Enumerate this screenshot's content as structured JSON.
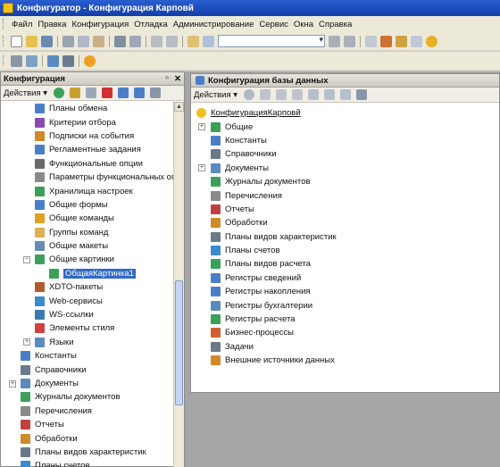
{
  "window": {
    "title": "Конфигуратор - Конфигурация Карповй"
  },
  "menu": [
    {
      "label": "Файл"
    },
    {
      "label": "Правка"
    },
    {
      "label": "Конфигурация"
    },
    {
      "label": "Отладка"
    },
    {
      "label": "Администрирование"
    },
    {
      "label": "Сервис"
    },
    {
      "label": "Окна"
    },
    {
      "label": "Справка"
    }
  ],
  "left_panel": {
    "title": "Конфигурация",
    "pin": " ⁿ",
    "close": "✕",
    "actions_label": "Действия ▾",
    "tree": [
      {
        "label": "Планы обмена",
        "indent": 2,
        "color": "#4a7fc8"
      },
      {
        "label": "Критерии отбора",
        "indent": 2,
        "color": "#8a4bb0"
      },
      {
        "label": "Подписки на события",
        "indent": 2,
        "color": "#d08a2a"
      },
      {
        "label": "Регламентные задания",
        "indent": 2,
        "color": "#4a7fc8"
      },
      {
        "label": "Функциональные опции",
        "indent": 2,
        "color": "#6a6a6a"
      },
      {
        "label": "Параметры функциональных опций",
        "indent": 2,
        "color": "#8a8a8a"
      },
      {
        "label": "Хранилища настроек",
        "indent": 2,
        "color": "#3aa05a"
      },
      {
        "label": "Общие формы",
        "indent": 2,
        "color": "#4a7fc8"
      },
      {
        "label": "Общие команды",
        "indent": 2,
        "color": "#e0a020"
      },
      {
        "label": "Группы команд",
        "indent": 2,
        "color": "#e0b050"
      },
      {
        "label": "Общие макеты",
        "indent": 2,
        "color": "#6a8ab0"
      },
      {
        "label": "Общие картинки",
        "indent": 2,
        "color": "#3aa05a",
        "expander": "−"
      },
      {
        "label": "ОбщаяКартинка1",
        "indent": 3,
        "color": "#3aa05a",
        "selected": true
      },
      {
        "label": "XDTO-пакеты",
        "indent": 2,
        "color": "#b05a30"
      },
      {
        "label": "Web-сервисы",
        "indent": 2,
        "color": "#3a8ad0"
      },
      {
        "label": "WS-ссылки",
        "indent": 2,
        "color": "#3a7ab0"
      },
      {
        "label": "Элементы стиля",
        "indent": 2,
        "color": "#d04040"
      },
      {
        "label": "Языки",
        "indent": 2,
        "color": "#5a8ac0",
        "expander": "+"
      },
      {
        "label": "Константы",
        "indent": 1,
        "color": "#4a7fc8"
      },
      {
        "label": "Справочники",
        "indent": 1,
        "color": "#6a7a8a"
      },
      {
        "label": "Документы",
        "indent": 1,
        "color": "#5a8ac0",
        "expander": "+"
      },
      {
        "label": "Журналы документов",
        "indent": 1,
        "color": "#3aa05a"
      },
      {
        "label": "Перечисления",
        "indent": 1,
        "color": "#8a8a8a"
      },
      {
        "label": "Отчеты",
        "indent": 1,
        "color": "#c04040"
      },
      {
        "label": "Обработки",
        "indent": 1,
        "color": "#d08a2a"
      },
      {
        "label": "Планы видов характеристик",
        "indent": 1,
        "color": "#6a7a8a"
      },
      {
        "label": "Планы счетов",
        "indent": 1,
        "color": "#3a8ad0"
      }
    ]
  },
  "right_panel": {
    "title": "Конфигурация базы данных",
    "actions_label": "Действия ▾",
    "root": "КонфигурацияКарповй",
    "tree": [
      {
        "label": "Общие",
        "color": "#3aa05a",
        "expander": "+"
      },
      {
        "label": "Константы",
        "color": "#4a7fc8"
      },
      {
        "label": "Справочники",
        "color": "#6a7a8a"
      },
      {
        "label": "Документы",
        "color": "#5a8ac0",
        "expander": "+"
      },
      {
        "label": "Журналы документов",
        "color": "#3aa05a"
      },
      {
        "label": "Перечисления",
        "color": "#8a8a8a"
      },
      {
        "label": "Отчеты",
        "color": "#c04040"
      },
      {
        "label": "Обработки",
        "color": "#d08a2a"
      },
      {
        "label": "Планы видов характеристик",
        "color": "#6a7a8a"
      },
      {
        "label": "Планы счетов",
        "color": "#3a8ad0"
      },
      {
        "label": "Планы видов расчета",
        "color": "#3aa05a"
      },
      {
        "label": "Регистры сведений",
        "color": "#4a7fc8"
      },
      {
        "label": "Регистры накопления",
        "color": "#4a7fc8"
      },
      {
        "label": "Регистры бухгалтерии",
        "color": "#5a8ac0"
      },
      {
        "label": "Регистры расчета",
        "color": "#3aa05a"
      },
      {
        "label": "Бизнес-процессы",
        "color": "#d06030"
      },
      {
        "label": "Задачи",
        "color": "#6a7a8a"
      },
      {
        "label": "Внешние источники данных",
        "color": "#d08a2a"
      }
    ]
  }
}
